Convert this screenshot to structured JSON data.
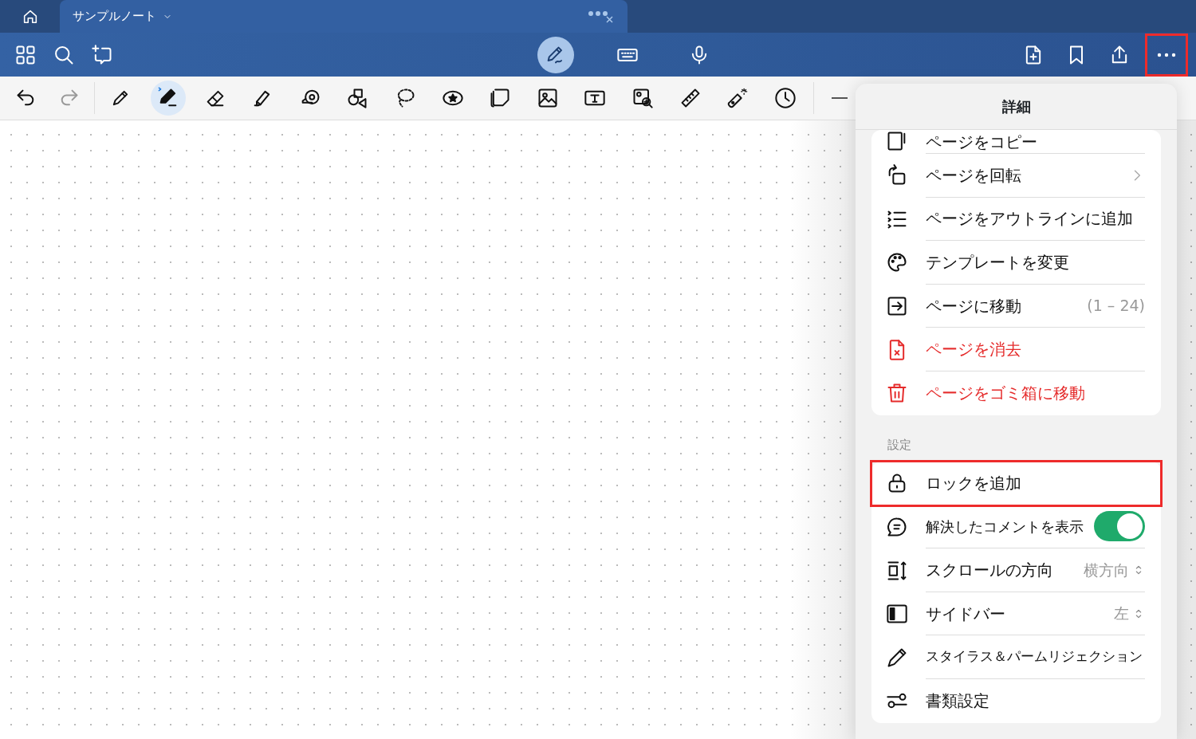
{
  "tab_bar": {
    "tabs": [
      {
        "title": "サンプルノート",
        "selected": true
      }
    ]
  },
  "top_toolbar": {
    "modes": [
      {
        "selected": true
      },
      {
        "selected": false
      },
      {
        "selected": false
      }
    ],
    "more_button": {
      "highlighted": true
    }
  },
  "tool_bar": {
    "history": [
      {
        "disabled": false
      },
      {
        "disabled": true
      }
    ],
    "tools": [
      {
        "selected": false
      },
      {
        "selected": true
      },
      {
        "selected": false
      },
      {
        "selected": false
      },
      {
        "selected": false
      },
      {
        "selected": false
      },
      {
        "selected": false
      },
      {
        "selected": false
      },
      {
        "selected": false
      },
      {
        "selected": false
      },
      {
        "selected": false
      },
      {
        "selected": false
      },
      {
        "selected": false
      },
      {
        "selected": false
      },
      {
        "selected": false
      },
      {
        "selected": false
      }
    ]
  },
  "menu": {
    "title": "詳細",
    "page_items": [
      {
        "label": "ページをコピー",
        "destructive": false
      },
      {
        "label": "ページを回転",
        "destructive": false,
        "kind": "submenu"
      },
      {
        "label": "ページをアウトラインに追加",
        "destructive": false
      },
      {
        "label": "テンプレートを変更",
        "destructive": false
      },
      {
        "label": "ページに移動",
        "destructive": false,
        "kind": "value",
        "value": "(1 – 24)"
      },
      {
        "label": "ページを消去",
        "destructive": true
      },
      {
        "label": "ページをゴミ箱に移動",
        "destructive": true
      }
    ],
    "settings_title": "設定",
    "settings_items": [
      {
        "label": "ロックを追加",
        "kind": "plain",
        "highlighted": true
      },
      {
        "label": "解決したコメントを表示",
        "kind": "toggle",
        "on": true,
        "highlighted": false
      },
      {
        "label": "スクロールの方向",
        "kind": "select",
        "value": "横方向",
        "highlighted": false
      },
      {
        "label": "サイドバー",
        "kind": "select",
        "value": "左",
        "highlighted": false
      },
      {
        "label": "スタイラス＆パームリジェクション",
        "kind": "plain",
        "highlighted": false
      },
      {
        "label": "書類設定",
        "kind": "plain",
        "highlighted": false
      }
    ]
  }
}
